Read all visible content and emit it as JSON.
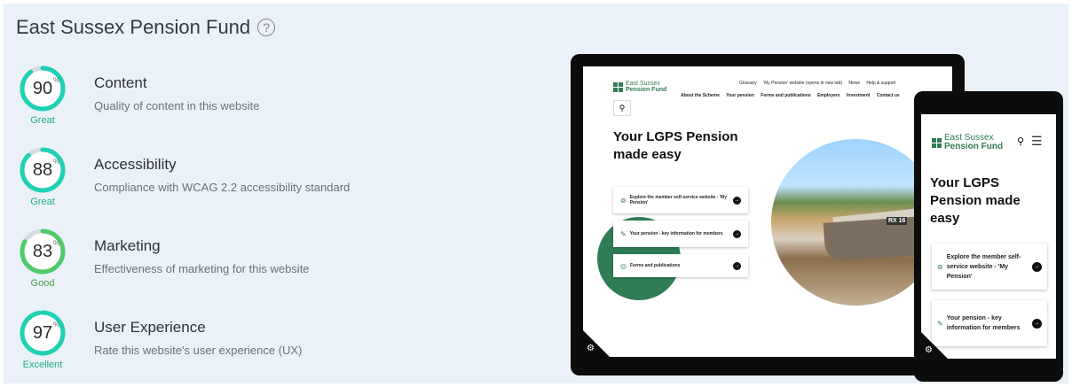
{
  "header": {
    "title": "East Sussex Pension Fund",
    "help_icon": "?"
  },
  "scores": [
    {
      "value": "90",
      "pct": "%",
      "rating": "Great",
      "category": "Content",
      "description": "Quality of content in this website",
      "fraction": 0.9,
      "color": "#1fd1b3"
    },
    {
      "value": "88",
      "pct": "%",
      "rating": "Great",
      "category": "Accessibility",
      "description": "Compliance with WCAG 2.2 accessibility standard",
      "fraction": 0.88,
      "color": "#1fd1b3"
    },
    {
      "value": "83",
      "pct": "%",
      "rating": "Good",
      "category": "Marketing",
      "description": "Effectiveness of marketing for this website",
      "fraction": 0.83,
      "color": "#52c96a"
    },
    {
      "value": "97",
      "pct": "%",
      "rating": "Excellent",
      "category": "User Experience",
      "description": "Rate this website's user experience (UX)",
      "fraction": 0.97,
      "color": "#1fd1b3"
    }
  ],
  "laptop": {
    "logo_top": "East Sussex",
    "logo_bottom": "Pension Fund",
    "top_links": [
      "Glossary",
      "'My Pension' website (opens in new tab)",
      "News",
      "Help & support"
    ],
    "nav": [
      "About the Scheme",
      "Your pension",
      "Forms and publications",
      "Employers",
      "Investment",
      "Contact us"
    ],
    "search_icon": "⚲",
    "hero_line1": "Your LGPS Pension",
    "hero_line2": "made easy",
    "boat_reg": "RX 16",
    "cards": [
      "Explore the member self-service website - 'My Pension'",
      "Your pension - key information for members",
      "Forms and publications"
    ],
    "gear_icon": "⚙"
  },
  "phone": {
    "logo_top": "East Sussex",
    "logo_bottom": "Pension Fund",
    "hero_line1": "Your LGPS",
    "hero_line2": "Pension made",
    "hero_line3": "easy",
    "cards": [
      "Explore the member self-service website - 'My Pension'",
      "Your pension - key information for members"
    ],
    "gear_icon": "⚙"
  }
}
